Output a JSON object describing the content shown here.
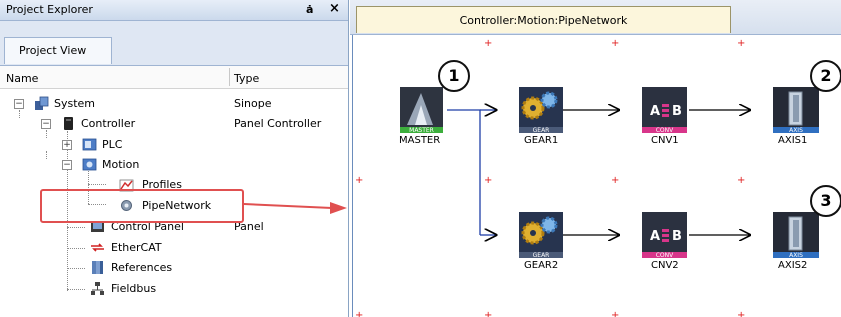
{
  "explorer": {
    "title": "Project Explorer",
    "pin_glyph": "ȧ",
    "close_glyph": "×",
    "tab": "Project View",
    "columns": {
      "name": "Name",
      "type": "Type"
    },
    "items": [
      {
        "label": "System",
        "type": "Sinope",
        "icon": "system-icon",
        "expander": "−"
      },
      {
        "label": "Controller",
        "type": "Panel Controller",
        "icon": "controller-icon",
        "expander": "−"
      },
      {
        "label": "PLC",
        "type": "",
        "icon": "plc-icon",
        "expander": "+"
      },
      {
        "label": "Motion",
        "type": "",
        "icon": "motion-icon",
        "expander": "−"
      },
      {
        "label": "Profiles",
        "type": "",
        "icon": "profiles-icon"
      },
      {
        "label": "PipeNetwork",
        "type": "",
        "icon": "pipenetwork-icon"
      },
      {
        "label": "Control Panel",
        "type": "Panel",
        "icon": "control-panel-icon"
      },
      {
        "label": "EtherCAT",
        "type": "",
        "icon": "ethercat-icon"
      },
      {
        "label": "References",
        "type": "",
        "icon": "references-icon"
      },
      {
        "label": "Fieldbus",
        "type": "",
        "icon": "fieldbus-icon"
      }
    ]
  },
  "editor": {
    "tab_title": "Controller:Motion:PipeNetwork",
    "nodes": [
      {
        "id": "master",
        "label": "MASTER",
        "badge": "MASTER",
        "kind": "master"
      },
      {
        "id": "gear1",
        "label": "GEAR1",
        "badge": "GEAR",
        "kind": "gear"
      },
      {
        "id": "cnv1",
        "label": "CNV1",
        "badge": "CONV",
        "kind": "conv"
      },
      {
        "id": "axis1",
        "label": "AXIS1",
        "badge": "AXIS",
        "kind": "axis"
      },
      {
        "id": "gear2",
        "label": "GEAR2",
        "badge": "GEAR",
        "kind": "gear"
      },
      {
        "id": "cnv2",
        "label": "CNV2",
        "badge": "CONV",
        "kind": "conv"
      },
      {
        "id": "axis2",
        "label": "AXIS2",
        "badge": "AXIS",
        "kind": "axis"
      }
    ],
    "conv_glyph_a": "A",
    "conv_glyph_b": "B",
    "callouts": [
      "1",
      "2",
      "3"
    ]
  },
  "colors": {
    "master_badge": "#3cae3c",
    "gear_badge": "#4a5a78",
    "conv_badge": "#d8358a",
    "axis_badge": "#2f6fc0",
    "wire": "#1f3fa8",
    "highlight": "#e05050",
    "grid_mark": "#e02020",
    "tab_bg": "#fcf6dc"
  }
}
